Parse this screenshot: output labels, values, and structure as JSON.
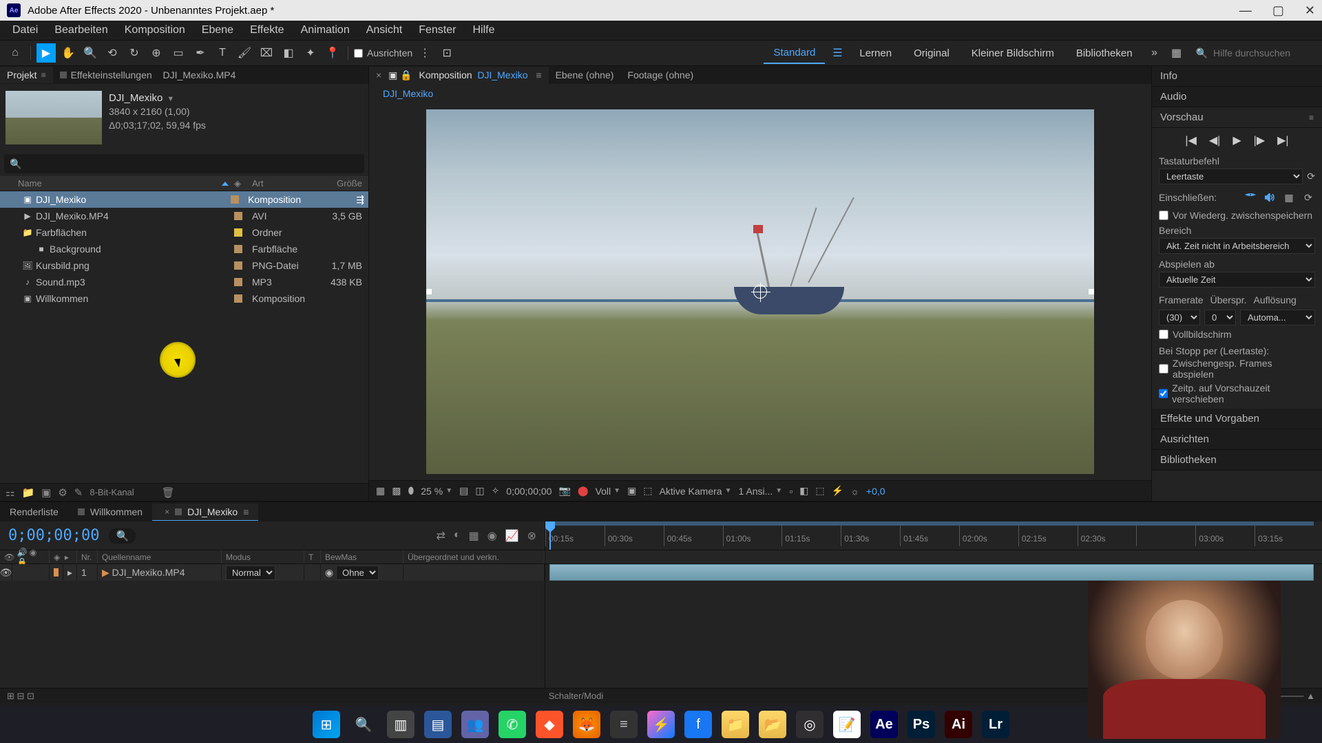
{
  "window": {
    "title": "Adobe After Effects 2020 - Unbenanntes Projekt.aep *"
  },
  "menu": [
    "Datei",
    "Bearbeiten",
    "Komposition",
    "Ebene",
    "Effekte",
    "Animation",
    "Ansicht",
    "Fenster",
    "Hilfe"
  ],
  "toolbar": {
    "snap_label": "Ausrichten",
    "workspaces": [
      "Standard",
      "Lernen",
      "Original",
      "Kleiner Bildschirm",
      "Bibliotheken"
    ],
    "search_placeholder": "Hilfe durchsuchen"
  },
  "project_panel": {
    "tabs": {
      "project": "Projekt",
      "effect_settings": "Effekteinstellungen",
      "effect_settings_target": "DJI_Mexiko.MP4"
    },
    "preview": {
      "name": "DJI_Mexiko",
      "resolution": "3840 x 2160 (1,00)",
      "duration": "Δ0;03;17;02, 59,94 fps"
    },
    "columns": {
      "name": "Name",
      "type": "Art",
      "size": "Größe"
    },
    "items": [
      {
        "name": "DJI_Mexiko",
        "type": "Komposition",
        "size": "",
        "icon": "comp",
        "label": "#b89060",
        "indent": 0,
        "selected": true
      },
      {
        "name": "DJI_Mexiko.MP4",
        "type": "AVI",
        "size": "3,5 GB",
        "icon": "video",
        "label": "#b89060",
        "indent": 0
      },
      {
        "name": "Farbflächen",
        "type": "Ordner",
        "size": "",
        "icon": "folder",
        "label": "#e0c040",
        "indent": 0
      },
      {
        "name": "Background",
        "type": "Farbfläche",
        "size": "",
        "icon": "solid",
        "label": "#b89060",
        "indent": 1
      },
      {
        "name": "Kursbild.png",
        "type": "PNG-Datei",
        "size": "1,7 MB",
        "icon": "image",
        "label": "#b89060",
        "indent": 0
      },
      {
        "name": "Sound.mp3",
        "type": "MP3",
        "size": "438 KB",
        "icon": "audio",
        "label": "#b89060",
        "indent": 0
      },
      {
        "name": "Willkommen",
        "type": "Komposition",
        "size": "",
        "icon": "comp",
        "label": "#b89060",
        "indent": 0
      }
    ],
    "footer": {
      "bit_depth": "8-Bit-Kanal"
    }
  },
  "comp_panel": {
    "comp_tab_prefix": "Komposition",
    "comp_name": "DJI_Mexiko",
    "layer_tab": "Ebene (ohne)",
    "footage_tab": "Footage (ohne)",
    "breadcrumb": "DJI_Mexiko",
    "footer": {
      "zoom": "25 %",
      "time": "0;00;00;00",
      "resolution": "Voll",
      "camera": "Aktive Kamera",
      "views": "1 Ansi...",
      "exposure": "+0,0"
    }
  },
  "right": {
    "info": "Info",
    "audio": "Audio",
    "preview": "Vorschau",
    "shortcut_label": "Tastaturbefehl",
    "shortcut_value": "Leertaste",
    "include_label": "Einschließen:",
    "cache_label": "Vor Wiederg. zwischenspeichern",
    "range_label": "Bereich",
    "range_value": "Akt. Zeit nicht in Arbeitsbereich",
    "playfrom_label": "Abspielen ab",
    "playfrom_value": "Aktuelle Zeit",
    "framerate_label": "Framerate",
    "framerate_value": "(30)",
    "skip_label": "Überspr.",
    "skip_value": "0",
    "res_label": "Auflösung",
    "res_value": "Automa...",
    "fullscreen_label": "Vollbildschirm",
    "onstop_label": "Bei Stopp per (Leertaste):",
    "cached_frames_label": "Zwischengesp. Frames abspielen",
    "move_time_label": "Zeitp. auf Vorschauzeit verschieben",
    "effects_presets": "Effekte und Vorgaben",
    "align": "Ausrichten",
    "libraries": "Bibliotheken"
  },
  "timeline": {
    "tabs": {
      "render": "Renderliste",
      "comp1": "Willkommen",
      "comp2": "DJI_Mexiko"
    },
    "timecode": "0;00;00;00",
    "cols": {
      "nr": "Nr.",
      "source": "Quellenname",
      "mode": "Modus",
      "t": "T",
      "trkmat": "BewMas",
      "parent": "Übergeordnet und verkn."
    },
    "ticks": [
      "00:15s",
      "00:30s",
      "00:45s",
      "01:00s",
      "01:15s",
      "01:30s",
      "01:45s",
      "02:00s",
      "02:15s",
      "02:30s",
      "",
      "03:00s",
      "03:15s"
    ],
    "layers": [
      {
        "nr": "1",
        "name": "DJI_Mexiko.MP4",
        "mode": "Normal",
        "trkmat": "Ohne",
        "label": "#d89050"
      }
    ],
    "footer_mode": "Schalter/Modi"
  },
  "taskbar_apps": [
    "windows",
    "search",
    "taskview",
    "explorer-tabs",
    "teams",
    "whatsapp",
    "brave",
    "firefox",
    "discord",
    "messenger",
    "facebook",
    "folder",
    "folder2",
    "obs",
    "notepad",
    "ae",
    "ps",
    "ai",
    "lr"
  ]
}
